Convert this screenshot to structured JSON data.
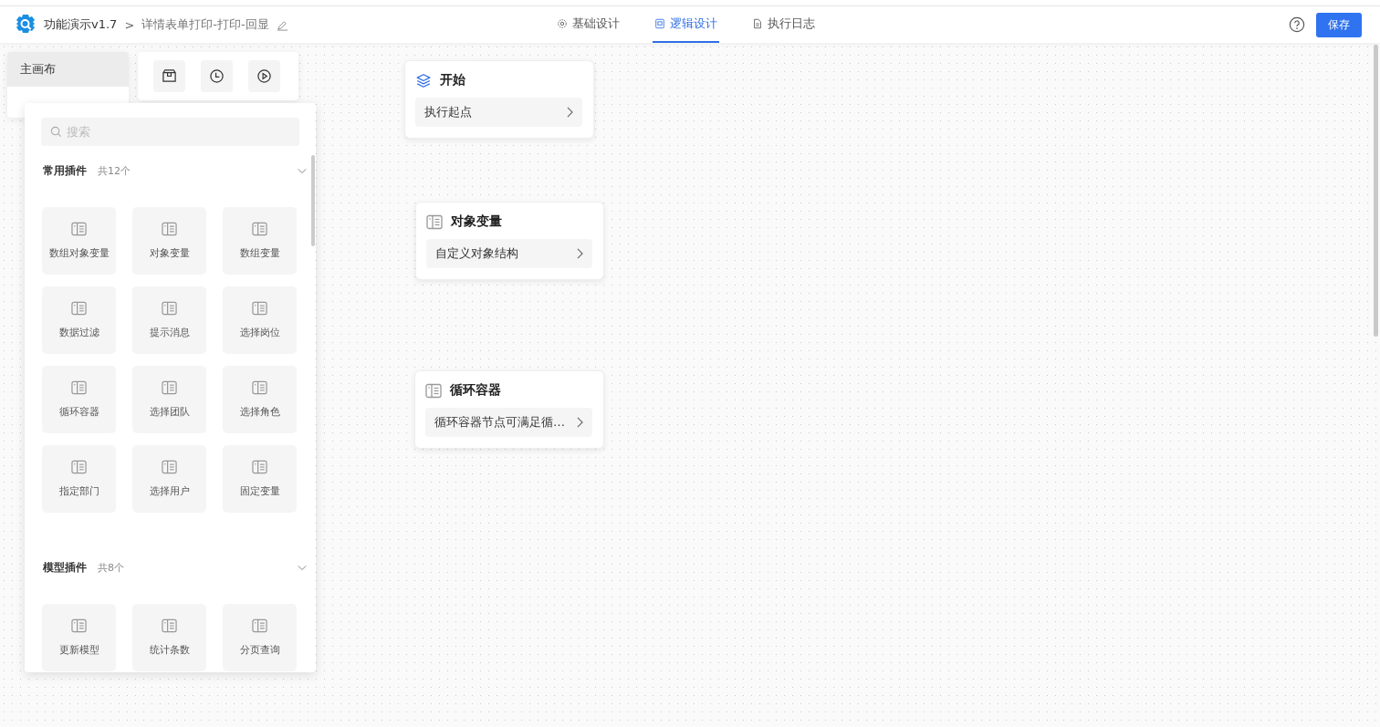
{
  "header": {
    "app_name": "功能演示v1.7",
    "breadcrumb_separator": ">",
    "page_title": "详情表单打印-打印-回显",
    "save_label": "保存"
  },
  "tabs": [
    {
      "label": "基础设计",
      "selected": false
    },
    {
      "label": "逻辑设计",
      "selected": true
    },
    {
      "label": "执行日志",
      "selected": false
    }
  ],
  "canvas_list": [
    {
      "label": "主画布",
      "selected": true
    }
  ],
  "plugin_panel": {
    "search": {
      "placeholder": "搜索"
    },
    "groups": [
      {
        "title": "常用插件",
        "count": "共12个",
        "expanded": true,
        "items": [
          "数组对象变量",
          "对象变量",
          "数组变量",
          "数据过滤",
          "提示消息",
          "选择岗位",
          "循环容器",
          "选择团队",
          "选择角色",
          "指定部门",
          "选择用户",
          "固定变量"
        ]
      },
      {
        "title": "模型插件",
        "count": "共8个",
        "expanded": true,
        "items": [
          "更新模型",
          "统计条数",
          "分页查询"
        ]
      }
    ]
  },
  "nodes": [
    {
      "kind": "start",
      "title": "开始",
      "detail": "执行起点"
    },
    {
      "kind": "plugin",
      "title": "对象变量",
      "detail": "自定义对象结构"
    },
    {
      "kind": "plugin",
      "title": "循环容器",
      "detail": "循环容器节点可满足循…"
    }
  ]
}
